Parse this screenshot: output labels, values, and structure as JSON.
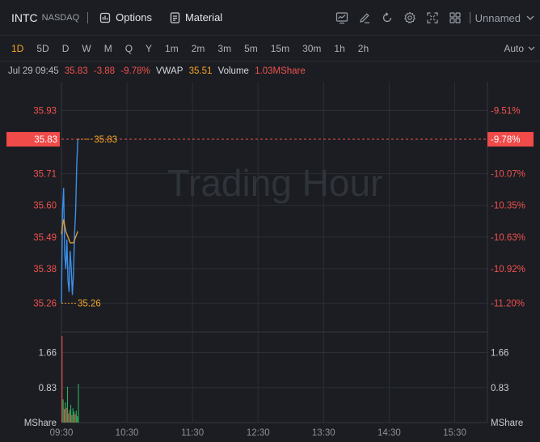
{
  "header": {
    "symbol": "INTC",
    "exchange": "NASDAQ",
    "options_label": "Options",
    "material_label": "Material",
    "layout_name": "Unnamed"
  },
  "periods": [
    "1D",
    "5D",
    "D",
    "W",
    "M",
    "Q",
    "Y",
    "1m",
    "2m",
    "3m",
    "5m",
    "15m",
    "30m",
    "1h",
    "2h"
  ],
  "active_period": "1D",
  "scale_mode": "Auto",
  "quote": {
    "datetime": "Jul 29 09:45",
    "price": "35.83",
    "change": "-3.88",
    "change_pct": "-9.78%",
    "vwap_label": "VWAP",
    "vwap_value": "35.51",
    "volume_label": "Volume",
    "volume_value": "1.03MShare"
  },
  "watermark": "Trading Hour",
  "colors": {
    "background": "#1b1d22",
    "grid": "#2b2f36",
    "down_red": "#f0514f",
    "up_green": "#27b35a",
    "accent_orange": "#f5a623",
    "price_line": "#3d8fe8",
    "vwap_line": "#d99a3c"
  },
  "chart_data": {
    "type": "line",
    "series": [
      {
        "name": "Price",
        "x": [
          "09:30",
          "09:31",
          "09:32",
          "09:33",
          "09:34",
          "09:35",
          "09:36",
          "09:37",
          "09:38",
          "09:39",
          "09:40",
          "09:41",
          "09:42",
          "09:43",
          "09:44",
          "09:45"
        ],
        "values": [
          35.26,
          35.58,
          35.66,
          35.43,
          35.38,
          35.48,
          35.34,
          35.3,
          35.44,
          35.38,
          35.29,
          35.36,
          35.5,
          35.58,
          35.74,
          35.83
        ]
      },
      {
        "name": "VWAP",
        "x": [
          "09:30",
          "09:31",
          "09:32",
          "09:33",
          "09:34",
          "09:35",
          "09:36",
          "09:37",
          "09:38",
          "09:39",
          "09:40",
          "09:41",
          "09:42",
          "09:43",
          "09:44",
          "09:45"
        ],
        "values": [
          35.5,
          35.53,
          35.55,
          35.53,
          35.51,
          35.5,
          35.49,
          35.48,
          35.47,
          35.47,
          35.47,
          35.47,
          35.48,
          35.49,
          35.5,
          35.51
        ]
      }
    ],
    "y_ticks": [
      "35.93",
      "35.71",
      "35.60",
      "35.49",
      "35.38",
      "35.26"
    ],
    "pct_ticks": [
      "-9.51%",
      "-10.07%",
      "-10.35%",
      "-10.63%",
      "-10.92%",
      "-11.20%"
    ],
    "current_price_label": "35.83",
    "current_pct_label": "-9.78%",
    "high_label": "35.83",
    "low_label": "35.26",
    "ylim": [
      35.16,
      36.03
    ],
    "x_ticks": [
      "09:30",
      "10:30",
      "11:30",
      "12:30",
      "13:30",
      "14:30",
      "15:30"
    ],
    "volume": {
      "unit": "MShare",
      "ticks": [
        "1.66",
        "0.83"
      ],
      "ylim": [
        0,
        2.15
      ],
      "bars": [
        {
          "v": 2.05,
          "dir": "down"
        },
        {
          "v": 0.55,
          "dir": "up"
        },
        {
          "v": 0.32,
          "dir": "down"
        },
        {
          "v": 0.48,
          "dir": "up"
        },
        {
          "v": 0.35,
          "dir": "down"
        },
        {
          "v": 0.85,
          "dir": "up"
        },
        {
          "v": 0.22,
          "dir": "down"
        },
        {
          "v": 0.3,
          "dir": "up"
        },
        {
          "v": 0.42,
          "dir": "up"
        },
        {
          "v": 0.18,
          "dir": "down"
        },
        {
          "v": 0.34,
          "dir": "up"
        },
        {
          "v": 0.26,
          "dir": "up"
        },
        {
          "v": 0.2,
          "dir": "down"
        },
        {
          "v": 0.28,
          "dir": "up"
        },
        {
          "v": 0.15,
          "dir": "up"
        },
        {
          "v": 0.92,
          "dir": "up"
        }
      ]
    }
  }
}
